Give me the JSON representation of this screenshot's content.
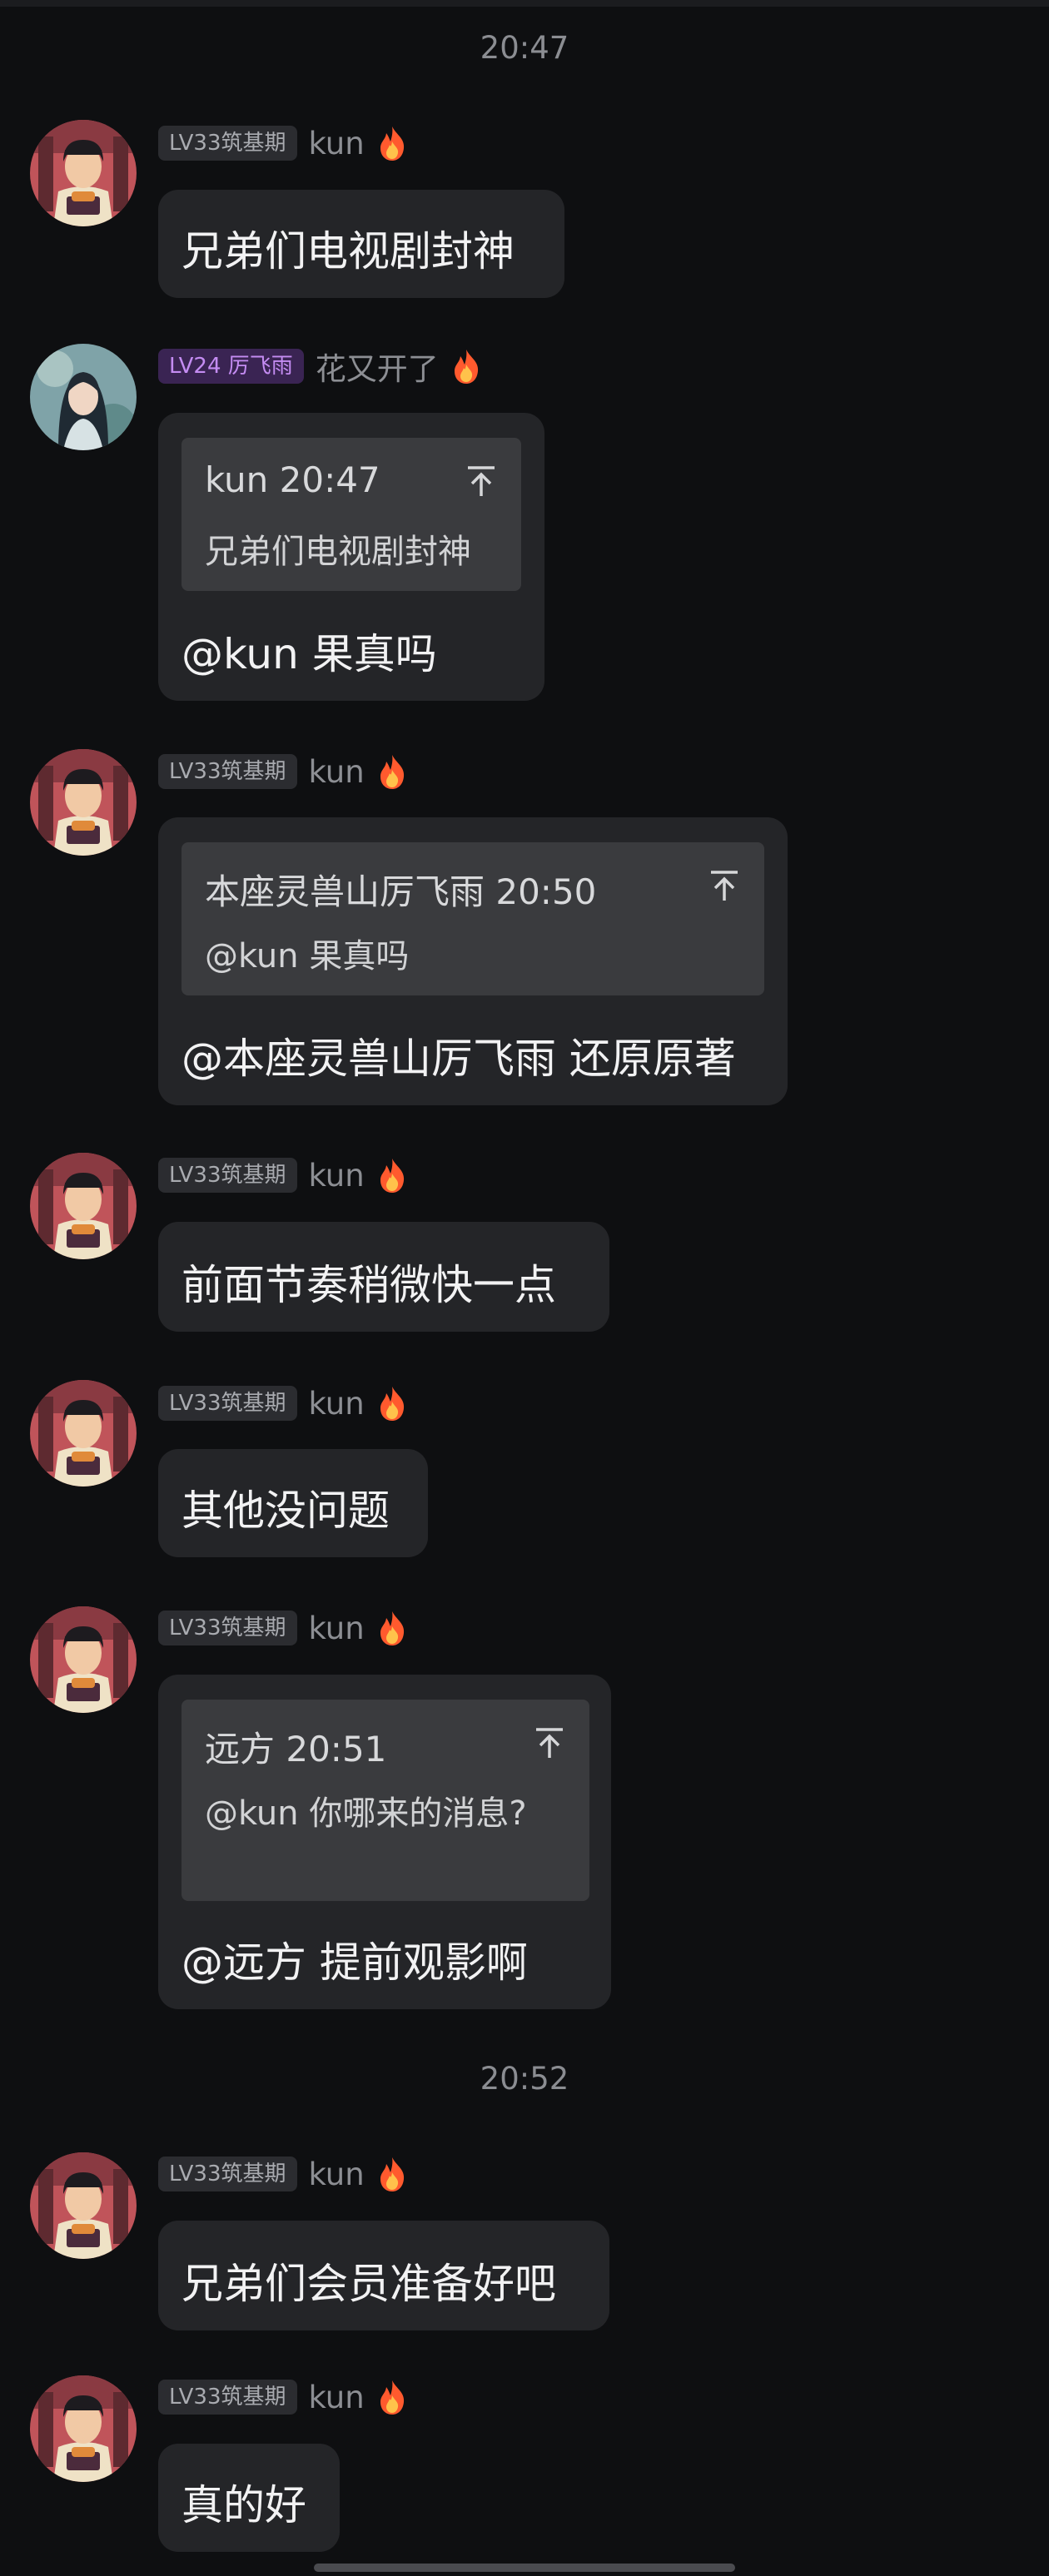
{
  "times": {
    "t1": "20:47",
    "t2": "20:52"
  },
  "messages": [
    {
      "badge": "LV33筑基期",
      "nick": "kun",
      "text": "兄弟们电视剧封神"
    },
    {
      "badge": "LV24 厉飞雨",
      "nick": "花又开了",
      "quote": {
        "header": "kun 20:47",
        "body": "兄弟们电视剧封神"
      },
      "text": "@kun 果真吗"
    },
    {
      "badge": "LV33筑基期",
      "nick": "kun",
      "quote": {
        "header": "本座灵兽山厉飞雨 20:50",
        "body": "@kun 果真吗"
      },
      "text": "@本座灵兽山厉飞雨 还原原著"
    },
    {
      "badge": "LV33筑基期",
      "nick": "kun",
      "text": "前面节奏稍微快一点"
    },
    {
      "badge": "LV33筑基期",
      "nick": "kun",
      "text": "其他没问题"
    },
    {
      "badge": "LV33筑基期",
      "nick": "kun",
      "quote": {
        "header": "远方 20:51",
        "body": "@kun 你哪来的消息?"
      },
      "text": "@远方 提前观影啊"
    },
    {
      "badge": "LV33筑基期",
      "nick": "kun",
      "text": "兄弟们会员准备好吧"
    },
    {
      "badge": "LV33筑基期",
      "nick": "kun",
      "text": "真的好"
    }
  ],
  "icons": {
    "flame": "flame-icon",
    "jump": "jump-to-message-icon"
  },
  "colors": {
    "background": "#0e0f11",
    "bubble": "#242528",
    "quote": "#3a3b3e",
    "badge_purple": "#c48cf2",
    "flame": "#ff5a2e"
  }
}
